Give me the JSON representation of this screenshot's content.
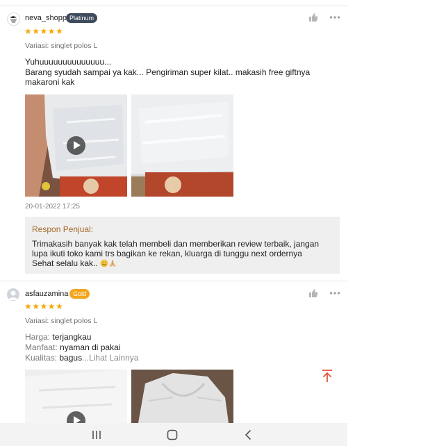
{
  "reviews": [
    {
      "username": "neva_shopp",
      "tier": "Platinum",
      "rating": "★★★★★",
      "variant": "Variasi: singlet polos L",
      "comment_line1": "Yuhuuuuuuuuuuuuuu...",
      "comment_line2": "Barang syudah sampai ya kak... Pengiriman super kilat..  makasih free giftnya makaroni kak",
      "date": "20-01-2022 17:25",
      "seller_response": {
        "title": "Respon Penjual:",
        "text": "Trimakasih banyak kak telah membeli dan memberikan review terbaik, jangan lupa ikuti toko kami trs bagikan ke rekan, kluarga di tunggu next ordernya",
        "text_last": "Sehat selalu kak.."
      }
    },
    {
      "username": "asfauzamina",
      "tier": "Gold",
      "rating": "★★★★★",
      "variant": "Variasi: singlet polos L",
      "attributes": [
        {
          "key": "Harga:",
          "value": "terjangkau"
        },
        {
          "key": "Manfaat:",
          "value": "nyaman di pakai"
        },
        {
          "key": "Kualitas:",
          "value": "bagus",
          "more": "...Lihat Lainnya"
        }
      ]
    }
  ],
  "icons": {
    "like": "thumbs-up-icon",
    "more": "more-dots-icon",
    "scroll_top": "scroll-to-top-icon",
    "nav_recents": "recents-icon",
    "nav_home": "home-icon",
    "nav_back": "back-icon"
  },
  "colors": {
    "star": "#f6a700",
    "platinum_badge": "#3f4a5c",
    "gold_badge": "#f4a51c",
    "seller_title": "#a46a2a",
    "scroll_top": "#e0563b"
  }
}
